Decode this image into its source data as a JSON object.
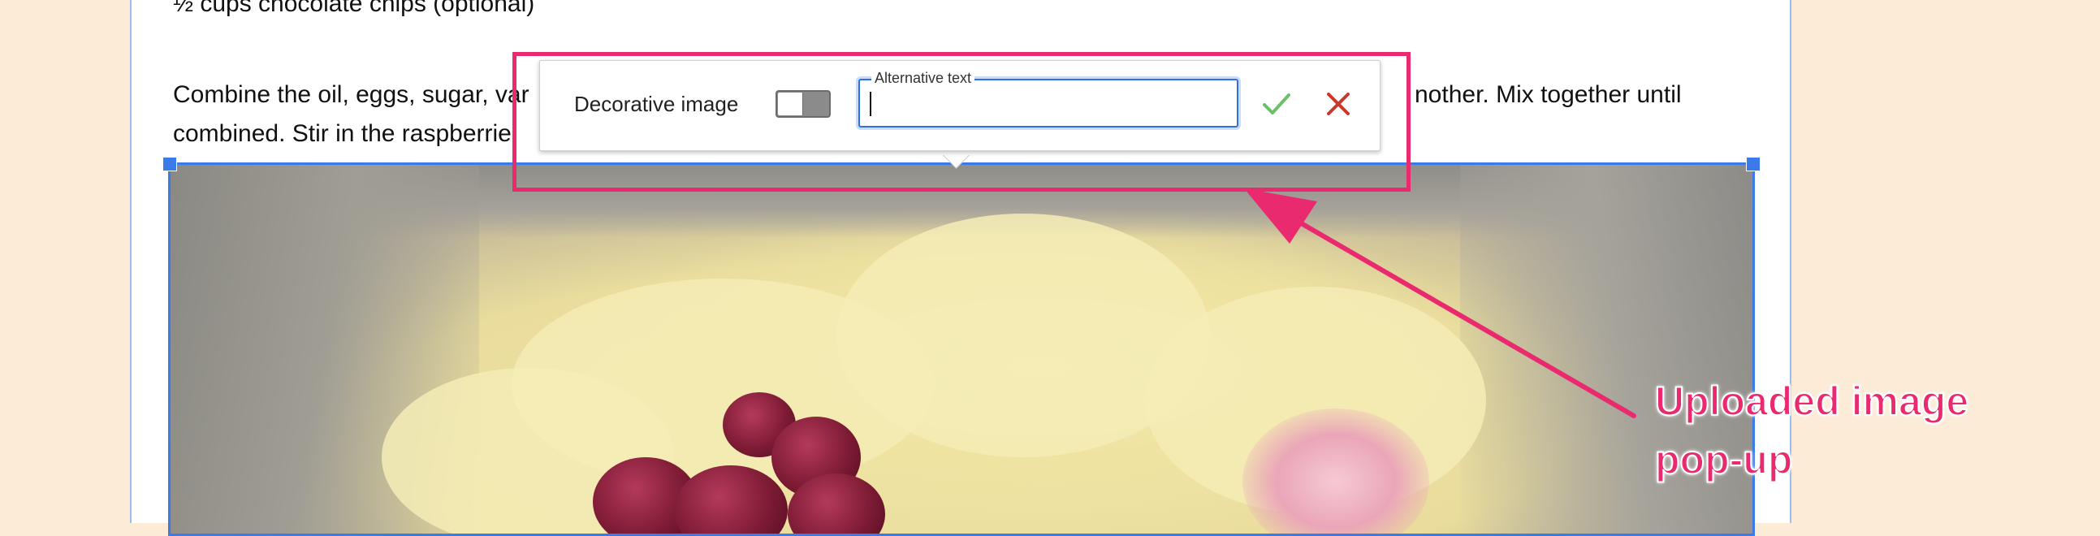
{
  "document": {
    "ingredient_line": "½ cups chocolate chips (optional)",
    "instruction_line1_left": "Combine the oil, eggs, sugar, var",
    "instruction_line1_right": "nother.  Mix together until",
    "instruction_line2": "combined.  Stir in the raspberrie"
  },
  "popup": {
    "decorative_label": "Decorative image",
    "decorative_toggle_on": false,
    "alt_text_label": "Alternative text",
    "alt_text_value": "",
    "confirm_icon": "checkmark-icon",
    "cancel_icon": "close-icon"
  },
  "annotation": {
    "callout_line1": "Uploaded image",
    "callout_line2": "pop-up",
    "color": "#ea2a6e"
  },
  "colors": {
    "accent_blue": "#3b7be9",
    "confirm_green": "#6cc06c",
    "cancel_red": "#c9392b"
  }
}
